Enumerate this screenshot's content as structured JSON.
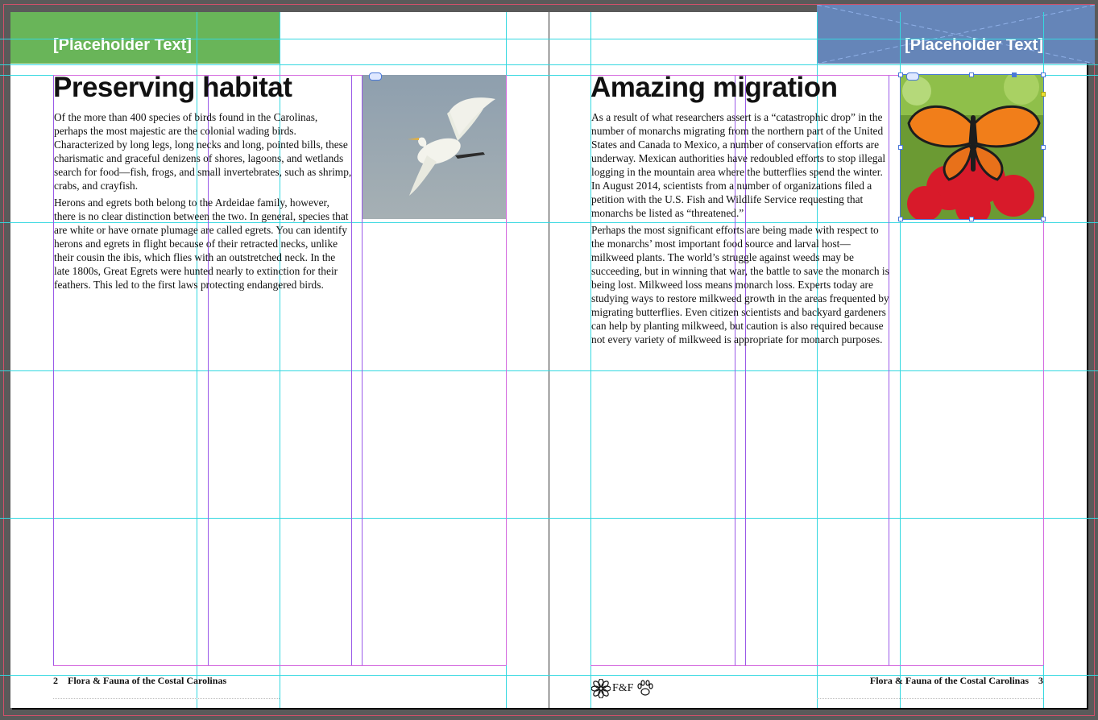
{
  "left_page": {
    "header": "[Placeholder Text]",
    "title": "Preserving habitat",
    "paragraphs": [
      "Of the more than 400 species of birds found in the Carolinas, perhaps the most majestic are the colonial wading birds. Characterized by long legs, long necks and long, pointed bills, these charismatic and graceful denizens of shores, lagoons, and wetlands search for food—fish, frogs, and small invertebrates, such as shrimp, crabs, and crayfish.",
      "Herons and egrets both belong to the Ardeidae family, however, there is no clear distinction between the two. In general, species that are white or have ornate plumage are called egrets. You can identify herons and egrets in flight because of their retracted necks, unlike their cousin the ibis, which flies with an outstretched neck. In the late 1800s, Great Egrets were hunted nearly to extinction for their feathers. This led to the first laws protecting endangered birds."
    ],
    "image": "egret-photo",
    "footer_number": "2",
    "footer_title": "Flora & Fauna of the Costal Carolinas"
  },
  "right_page": {
    "header": "[Placeholder Text]",
    "title": "Amazing migration",
    "paragraphs": [
      "As a result of what researchers assert is a “catastrophic drop” in the number of monarchs migrating from the northern part of the United States and Canada to Mexico, a number of conservation efforts are underway. Mexican authorities have redoubled efforts to stop illegal logging in the mountain area where the butterflies spend the winter. In August 2014, scientists from a number of organizations filed a petition with the U.S. Fish and Wildlife Service requesting that monarchs be listed as “threatened.”",
      "Perhaps the most significant efforts are being made with respect to the monarchs’ most important food source and larval host—milkweed plants. The world’s struggle against weeds may be succeeding, but in winning that war, the battle to save the monarch is being lost. Milkweed loss means monarch loss. Experts today are studying ways to restore milkweed growth in the areas frequented by migrating butterflies. Even citizen scientists and backyard gardeners can help by planting milkweed, but caution is also required because not every variety of milkweed is appropriate for monarch purposes."
    ],
    "image": "monarch-butterfly-photo",
    "footer_title": "Flora & Fauna of the Costal Carolinas",
    "footer_number": "3"
  },
  "logo": {
    "text": "F&F",
    "icons": [
      "flower-icon",
      "paw-prints-icon"
    ]
  },
  "colors": {
    "green_band": "#69b559",
    "blue_band": "#6585b8",
    "guide": "#34d8e0",
    "column_guide": "#9a5ae8",
    "margin_guide": "#d46adf",
    "pasteboard": "#5a5a5a"
  }
}
